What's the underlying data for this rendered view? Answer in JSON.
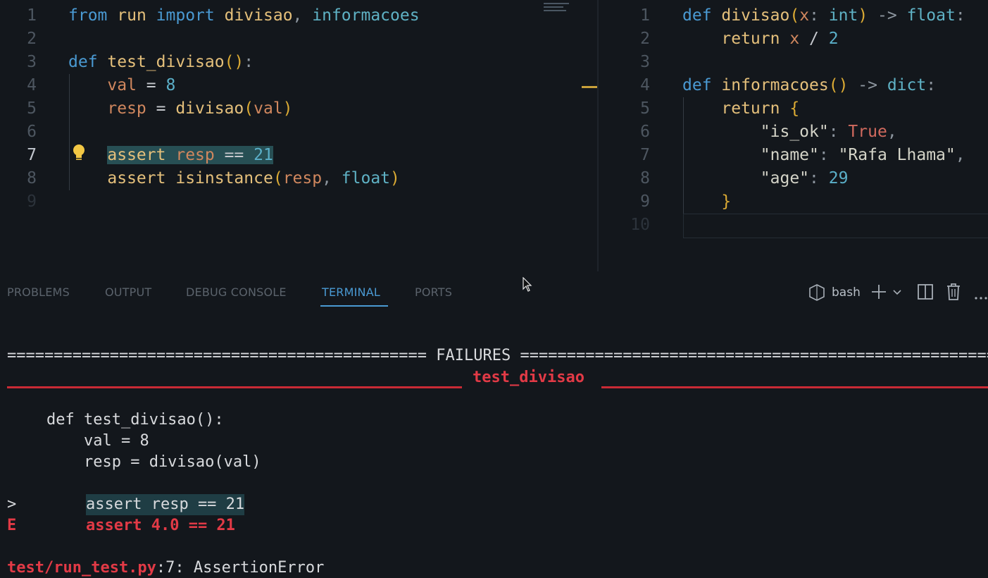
{
  "editor_left": {
    "lines": [
      {
        "n": "1",
        "tokens": [
          [
            "kw",
            "from"
          ],
          [
            "op",
            " "
          ],
          [
            "var2",
            "run"
          ],
          [
            "op",
            " "
          ],
          [
            "kw",
            "import"
          ],
          [
            "op",
            " "
          ],
          [
            "fn",
            "divisao"
          ],
          [
            "pn",
            ", "
          ],
          [
            "tp",
            "informacoes"
          ]
        ]
      },
      {
        "n": "2",
        "tokens": []
      },
      {
        "n": "3",
        "tokens": [
          [
            "kw",
            "def"
          ],
          [
            "op",
            " "
          ],
          [
            "fn",
            "test_divisao"
          ],
          [
            "br",
            "()"
          ],
          [
            "pn",
            ":"
          ]
        ]
      },
      {
        "n": "4",
        "tokens": [
          [
            "op",
            "    "
          ],
          [
            "var",
            "val"
          ],
          [
            "op",
            " = "
          ],
          [
            "num",
            "8"
          ]
        ]
      },
      {
        "n": "5",
        "tokens": [
          [
            "op",
            "    "
          ],
          [
            "var",
            "resp"
          ],
          [
            "op",
            " = "
          ],
          [
            "fn",
            "divisao"
          ],
          [
            "br",
            "("
          ],
          [
            "var",
            "val"
          ],
          [
            "br",
            ")"
          ]
        ]
      },
      {
        "n": "6",
        "tokens": []
      },
      {
        "n": "7",
        "tokens": [
          [
            "op",
            "    "
          ],
          [
            "hlstart",
            ""
          ],
          [
            "kw2",
            "assert"
          ],
          [
            "op",
            " "
          ],
          [
            "var",
            "resp"
          ],
          [
            "op",
            " == "
          ],
          [
            "num",
            "21"
          ],
          [
            "hlend",
            ""
          ]
        ]
      },
      {
        "n": "8",
        "tokens": [
          [
            "op",
            "    "
          ],
          [
            "kw2",
            "assert"
          ],
          [
            "op",
            " "
          ],
          [
            "fn",
            "isinstance"
          ],
          [
            "br",
            "("
          ],
          [
            "var",
            "resp"
          ],
          [
            "pn",
            ", "
          ],
          [
            "tp",
            "float"
          ],
          [
            "br",
            ")"
          ]
        ]
      },
      {
        "n": "9",
        "tokens": []
      }
    ]
  },
  "editor_right": {
    "lines": [
      {
        "n": "1",
        "tokens": [
          [
            "kw",
            "def"
          ],
          [
            "op",
            " "
          ],
          [
            "fn",
            "divisao"
          ],
          [
            "br",
            "("
          ],
          [
            "var",
            "x"
          ],
          [
            "pn",
            ": "
          ],
          [
            "tp",
            "int"
          ],
          [
            "br",
            ")"
          ],
          [
            "pn",
            " -> "
          ],
          [
            "tp",
            "float"
          ],
          [
            "pn",
            ":"
          ]
        ]
      },
      {
        "n": "2",
        "tokens": [
          [
            "op",
            "    "
          ],
          [
            "kw2",
            "return"
          ],
          [
            "op",
            " "
          ],
          [
            "var",
            "x"
          ],
          [
            "op",
            " / "
          ],
          [
            "num",
            "2"
          ]
        ]
      },
      {
        "n": "3",
        "tokens": []
      },
      {
        "n": "4",
        "tokens": [
          [
            "kw",
            "def"
          ],
          [
            "op",
            " "
          ],
          [
            "fn",
            "informacoes"
          ],
          [
            "br",
            "()"
          ],
          [
            "pn",
            " -> "
          ],
          [
            "tp",
            "dict"
          ],
          [
            "pn",
            ":"
          ]
        ]
      },
      {
        "n": "5",
        "tokens": [
          [
            "op",
            "    "
          ],
          [
            "kw2",
            "return"
          ],
          [
            "op",
            " "
          ],
          [
            "br",
            "{"
          ]
        ]
      },
      {
        "n": "6",
        "tokens": [
          [
            "op",
            "        "
          ],
          [
            "str",
            "\"is_ok\""
          ],
          [
            "pn",
            ": "
          ],
          [
            "bool",
            "True"
          ],
          [
            "pn",
            ","
          ]
        ]
      },
      {
        "n": "7",
        "tokens": [
          [
            "op",
            "        "
          ],
          [
            "str",
            "\"name\""
          ],
          [
            "pn",
            ": "
          ],
          [
            "str",
            "\"Rafa Lhama\""
          ],
          [
            "pn",
            ","
          ]
        ]
      },
      {
        "n": "8",
        "tokens": [
          [
            "op",
            "        "
          ],
          [
            "str",
            "\"age\""
          ],
          [
            "pn",
            ": "
          ],
          [
            "num",
            "29"
          ]
        ]
      },
      {
        "n": "9",
        "tokens": [
          [
            "op",
            "    "
          ],
          [
            "br",
            "}"
          ]
        ]
      },
      {
        "n": "10",
        "tokens": []
      }
    ]
  },
  "panel": {
    "tabs": [
      "PROBLEMS",
      "OUTPUT",
      "DEBUG CONSOLE",
      "TERMINAL",
      "PORTS"
    ],
    "active_tab": "TERMINAL",
    "shell": "bash"
  },
  "terminal": {
    "failures_rule": "============================================= FAILURES =============================================================",
    "failures_left": "=============================================",
    "failures_title": "FAILURES",
    "failures_right": "=========================================================",
    "test_title": "test_divisao",
    "code_lines": [
      "def test_divisao():",
      "    val = 8",
      "    resp = divisao(val)"
    ],
    "pointer_marker": ">",
    "pointer_code": "assert resp == 21",
    "error_marker": "E",
    "error_code": "assert 4.0 == 21",
    "location_file": "test/run_test.py",
    "location_rest": ":7: AssertionError"
  },
  "colors": {
    "background": "#13171c",
    "accent": "#4a9ad3",
    "error": "#e23a46"
  }
}
